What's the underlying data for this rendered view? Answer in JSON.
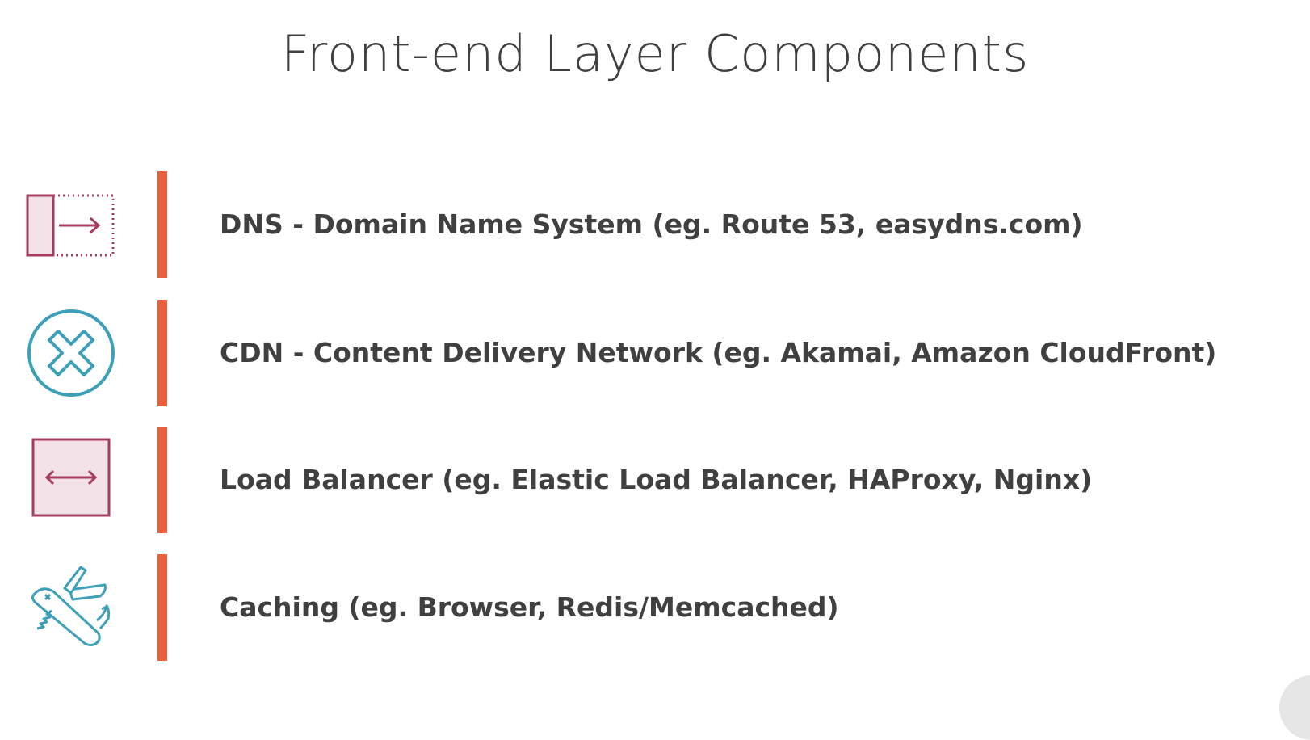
{
  "slide": {
    "title": "Front-end Layer Components"
  },
  "colors": {
    "divider": "#E8603C",
    "magenta": "#A63D60",
    "magenta_fill": "#F3E1E8",
    "teal": "#3EA0B8",
    "text": "#404040"
  },
  "components": [
    {
      "icon": "dns-redirect-icon",
      "label": "DNS - Domain Name System (eg. Route 53, easydns.com)"
    },
    {
      "icon": "cdn-cross-circle-icon",
      "label": "CDN - Content Delivery Network (eg. Akamai, Amazon CloudFront)"
    },
    {
      "icon": "load-balancer-arrows-icon",
      "label": "Load Balancer (eg. Elastic Load Balancer, HAProxy, Nginx)"
    },
    {
      "icon": "swiss-army-knife-icon",
      "label": "Caching (eg. Browser, Redis/Memcached)"
    }
  ]
}
